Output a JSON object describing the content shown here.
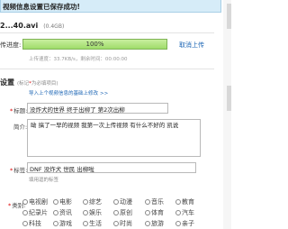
{
  "toast": {
    "message": "视频信息设置已保存成功!"
  },
  "file": {
    "name": "2...40.avi",
    "size": "(0.4GB)"
  },
  "upload": {
    "progress_label": "传进度:",
    "progress_fraction": 1.0,
    "percent_text": "100%",
    "cancel_label": "取消上传",
    "speed_text": "上传速度：33.7KB/s，剩余时间：00:00:00"
  },
  "settings": {
    "section_title": "设置",
    "required_tip": "(标记",
    "required_star": "*",
    "required_tip_rest": "为必填项目)",
    "import_link": "导入上个视频信息的基础上修改",
    "import_chevron": ">>"
  },
  "fields": {
    "title": {
      "star": "*",
      "label": "标题:",
      "value": "没炸犬的世界 终于出柳了 第2次出柳"
    },
    "description": {
      "label": "简介:",
      "value": "呦 搞了一早的视频  我第一次上传视频   有什么不好的 凯说"
    },
    "tags": {
      "star": "*",
      "label": "标签:",
      "value": "DNF 没炸犬 世民 出柳啦",
      "hint": "填用逗的标签"
    },
    "category": {
      "star": "*",
      "label": "类别:",
      "options": [
        [
          "电视剧",
          "电影",
          "综艺",
          "动漫",
          "音乐",
          "教育"
        ],
        [
          "纪录片",
          "资讯",
          "娱乐",
          "原创",
          "体育",
          "汽车"
        ],
        [
          "科技",
          "游戏",
          "生活",
          "时尚",
          "旅游",
          "亲子"
        ]
      ]
    }
  },
  "icons": {
    "radio": "radio-button-icon",
    "chevron": "double-chevron-right-icon"
  },
  "colors": {
    "toast_bg": "#d6ecf8",
    "progress_fill": "#9fdc6a",
    "link": "#1a64b4",
    "required": "#d00000"
  }
}
